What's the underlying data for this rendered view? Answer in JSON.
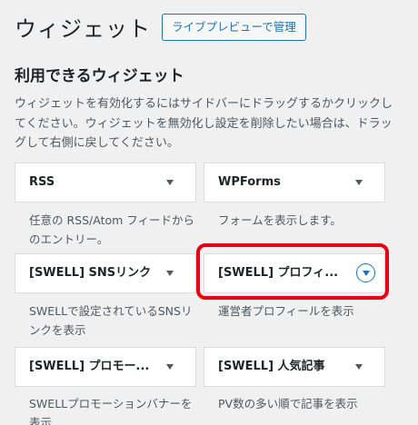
{
  "header": {
    "title": "ウィジェット",
    "manage_button": "ライブプレビューで管理"
  },
  "available": {
    "heading": "利用できるウィジェット",
    "description": "ウィジェットを有効化するにはサイドバーにドラッグするかクリックしてください。ウィジェットを無効化し設定を削除したい場合は、ドラッグして右側に戻してください。"
  },
  "widgets": [
    {
      "title": "RSS",
      "desc": "任意の RSS/Atom フィードからのエントリー。",
      "selected": false
    },
    {
      "title": "WPForms",
      "desc": "フォームを表示します。",
      "selected": false
    },
    {
      "title": "[SWELL] SNSリンク",
      "desc": "SWELLで設定されているSNSリンクを表示",
      "selected": false
    },
    {
      "title": "[SWELL] プロフィ...",
      "desc": "運営者プロフィールを表示",
      "selected": true
    },
    {
      "title": "[SWELL] プロモー...",
      "desc": "SWELLプロモーションバナーを表示",
      "selected": false
    },
    {
      "title": "[SWELL] 人気記事",
      "desc": "PV数の多い順で記事を表示",
      "selected": false
    }
  ],
  "icons": {
    "toggle": "caret-down-icon"
  },
  "colors": {
    "accent": "#2271b1",
    "highlight": "#e60012",
    "background": "#f0f0f1"
  }
}
